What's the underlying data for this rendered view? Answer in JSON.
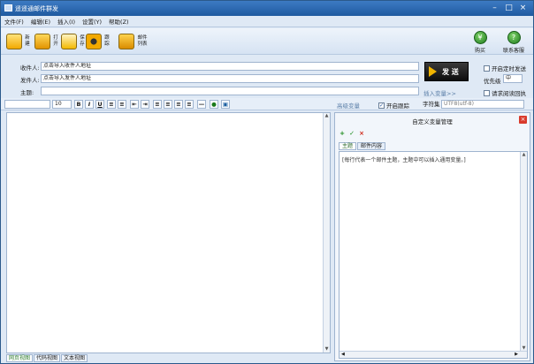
{
  "window": {
    "title": "遥遥通邮件群发"
  },
  "menu": [
    "文件(F)",
    "编辑(E)",
    "插入(I)",
    "设置(Y)",
    "帮助(Z)"
  ],
  "toolbar": {
    "new": "新建",
    "open": "打开",
    "save": "保存",
    "trace": "跟踪",
    "mail_list": "邮件列表",
    "buy": "购买",
    "contact": "联系客服"
  },
  "compose": {
    "to_label": "收件人:",
    "to_value": "点击导入收件人地址",
    "from_label": "发件人:",
    "from_value": "点击导入发件人地址",
    "subject_label": "主题:",
    "subject_value": "",
    "send_label": "发 送",
    "scheduled_label": "开启定时发送",
    "priority_label": "优先级",
    "priority_value": "中",
    "read_receipt_label": "请求阅读回执",
    "insert_var_link": "插入变量>>",
    "advanced_var_link": "高级变量",
    "tracking_label": "开启跟踪",
    "charset_label": "字符集",
    "charset_value": "UTF8(utf-8)"
  },
  "format": {
    "font_value": "",
    "size_value": "10",
    "bold": "B",
    "italic": "I",
    "underline": "U"
  },
  "view_tabs": [
    "网页视图",
    "代码视图",
    "文本视图"
  ],
  "var_panel": {
    "title": "自定义变量管理",
    "tabs": [
      "主题",
      "邮件内容"
    ],
    "hint": "[每行代表一个邮件主题，主题中可以插入通用变量。]"
  }
}
